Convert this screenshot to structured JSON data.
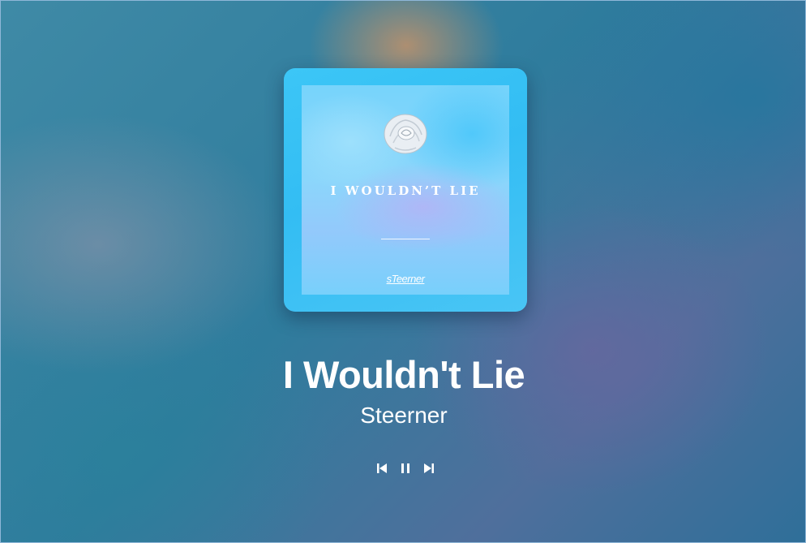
{
  "cover": {
    "title": "I WOULDN’T LIE",
    "logo": "sTeerner"
  },
  "now_playing": {
    "title": "I Wouldn't Lie",
    "artist": "Steerner",
    "state": "playing"
  },
  "controls": {
    "previous_icon": "skip-previous-icon",
    "pause_icon": "pause-icon",
    "next_icon": "skip-next-icon"
  },
  "colors": {
    "cover_bg": "#33bdf3",
    "text": "#ffffff"
  }
}
